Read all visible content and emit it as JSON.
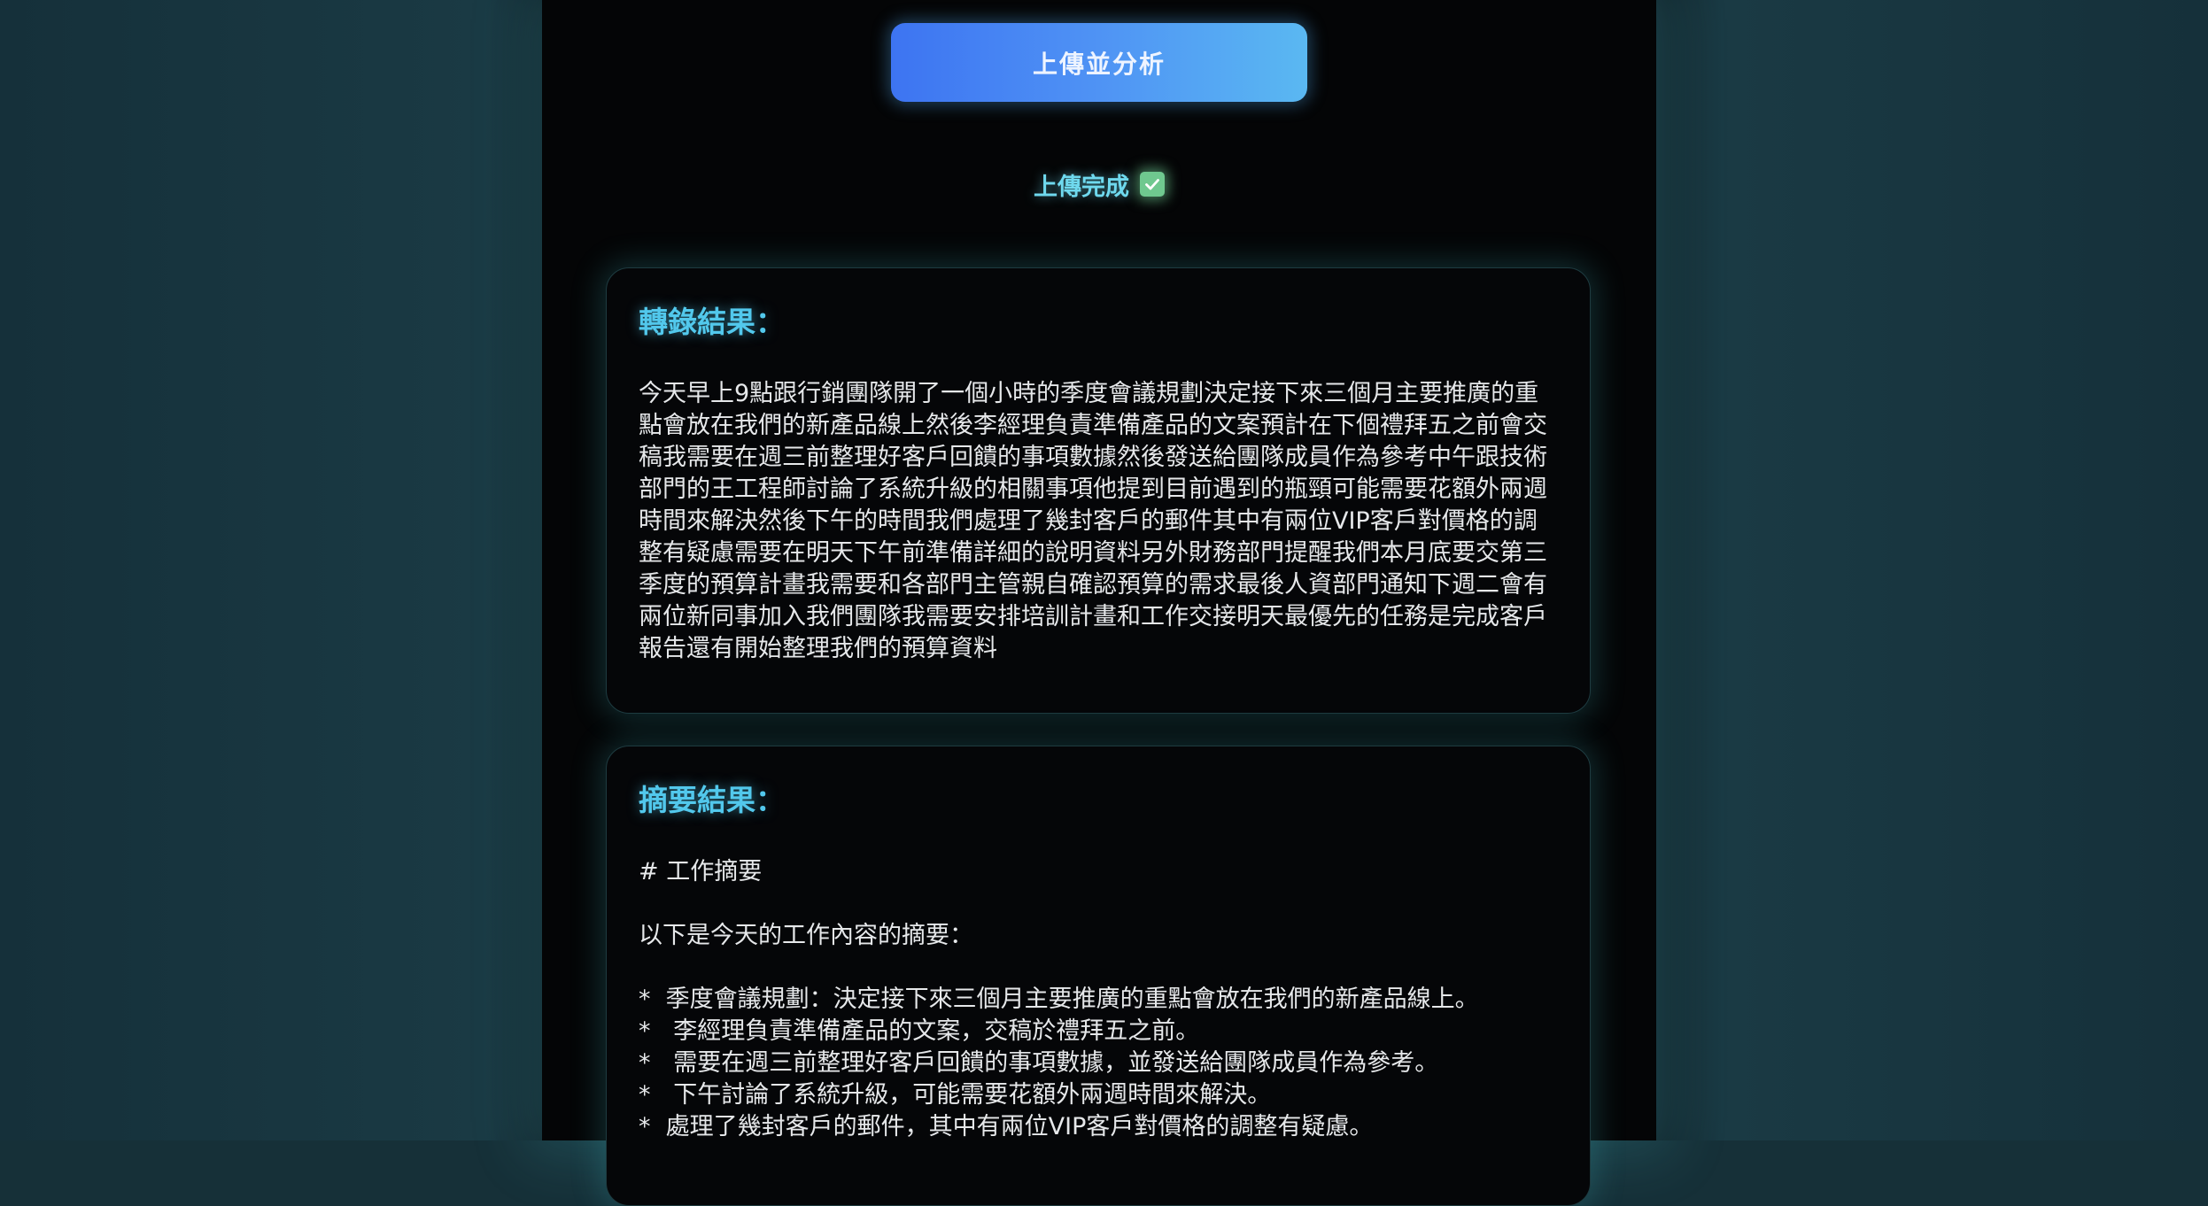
{
  "upload_button": {
    "label": "上傳並分析"
  },
  "status": {
    "text": "上傳完成",
    "icon": "check-box-icon"
  },
  "transcript": {
    "title": "轉錄結果：",
    "text": "今天早上9點跟行銷團隊開了一個小時的季度會議規劃決定接下來三個月主要推廣的重點會放在我們的新產品線上然後李經理負責準備產品的文案預計在下個禮拜五之前會交稿我需要在週三前整理好客戶回饋的事項數據然後發送給團隊成員作為參考中午跟技術部門的王工程師討論了系統升級的相關事項他提到目前遇到的瓶頸可能需要花額外兩週時間來解決然後下午的時間我們處理了幾封客戶的郵件其中有兩位VIP客戶對價格的調整有疑慮需要在明天下午前準備詳細的說明資料另外財務部門提醒我們本月底要交第三季度的預算計畫我需要和各部門主管親自確認預算的需求最後人資部門通知下週二會有兩位新同事加入我們團隊我需要安排培訓計畫和工作交接明天最優先的任務是完成客戶報告還有開始整理我們的預算資料"
  },
  "summary": {
    "title": "摘要結果：",
    "heading": "# 工作摘要",
    "intro": "以下是今天的工作內容的摘要：",
    "items": [
      "*  季度會議規劃：決定接下來三個月主要推廣的重點會放在我們的新產品線上。",
      "*   李經理負責準備產品的文案，交稿於禮拜五之前。",
      "*   需要在週三前整理好客戶回饋的事項數據，並發送給團隊成員作為參考。",
      "*   下午討論了系統升級，可能需要花額外兩週時間來解決。",
      "*  處理了幾封客戶的郵件，其中有兩位VIP客戶對價格的調整有疑慮。"
    ]
  },
  "colors": {
    "accent": "#52c8ec",
    "button_gradient_start": "#3d74f2",
    "button_gradient_end": "#5ab8f2",
    "status_text": "#6fd9ee",
    "check_icon": "#6fc88f"
  }
}
